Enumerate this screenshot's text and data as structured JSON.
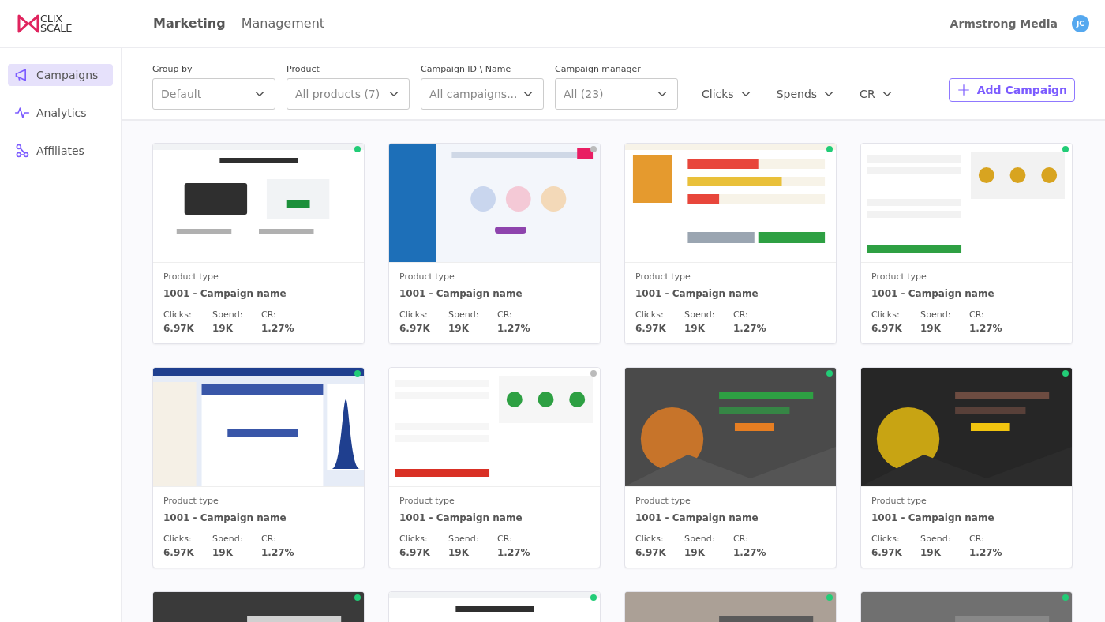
{
  "logo": {
    "line_1": "CLIX",
    "line_2": "SCALE"
  },
  "top_nav": [
    {
      "label": "Marketing",
      "selected": true
    },
    {
      "label": "Management",
      "selected": false
    }
  ],
  "account": {
    "name": "Armstrong Media",
    "avatar_initials": "JC"
  },
  "sidebar": {
    "items": [
      {
        "label": "Campaigns",
        "selected": true
      },
      {
        "label": "Analytics",
        "selected": false
      },
      {
        "label": "Affiliates",
        "selected": false
      }
    ]
  },
  "filters": [
    {
      "label": "Group by",
      "value": "Default"
    },
    {
      "label": "Product",
      "value": "All products (7)"
    },
    {
      "label": "Campaign ID \\ Name",
      "value": "All campaigns..."
    },
    {
      "label": "Campaign manager",
      "value": "All (23)"
    }
  ],
  "sort_menus": [
    "Clicks",
    "Spends",
    "CR"
  ],
  "add_button": "Add Campaign",
  "cards": [
    {
      "kind": "picture",
      "active": true,
      "product_type": "Product type",
      "name": "1001 - Campaign name",
      "stats": [
        {
          "label": "Clicks:",
          "value": "6.97K"
        },
        {
          "label": "Spend:",
          "value": "19K"
        },
        {
          "label": "CR:",
          "value": "1.27%"
        }
      ]
    },
    {
      "kind": "picture",
      "active": false,
      "product_type": "Product type",
      "name": "1001 - Campaign name",
      "stats": [
        {
          "label": "Clicks:",
          "value": "6.97K"
        },
        {
          "label": "Spend:",
          "value": "19K"
        },
        {
          "label": "CR:",
          "value": "1.27%"
        }
      ]
    },
    {
      "kind": "picture",
      "active": true,
      "product_type": "Product type",
      "name": "1001 - Campaign name",
      "stats": [
        {
          "label": "Clicks:",
          "value": "6.97K"
        },
        {
          "label": "Spend:",
          "value": "19K"
        },
        {
          "label": "CR:",
          "value": "1.27%"
        }
      ]
    },
    {
      "kind": "picture",
      "active": true,
      "product_type": "Product type",
      "name": "1001 - Campaign name",
      "stats": [
        {
          "label": "Clicks:",
          "value": "6.97K"
        },
        {
          "label": "Spend:",
          "value": "19K"
        },
        {
          "label": "CR:",
          "value": "1.27%"
        }
      ]
    },
    {
      "kind": "picture",
      "active": true,
      "product_type": "Product type",
      "name": "1001 - Campaign name",
      "stats": [
        {
          "label": "Clicks:",
          "value": "6.97K"
        },
        {
          "label": "Spend:",
          "value": "19K"
        },
        {
          "label": "CR:",
          "value": "1.27%"
        }
      ]
    },
    {
      "kind": "picture",
      "active": false,
      "product_type": "Product type",
      "name": "1001 - Campaign name",
      "stats": [
        {
          "label": "Clicks:",
          "value": "6.97K"
        },
        {
          "label": "Spend:",
          "value": "19K"
        },
        {
          "label": "CR:",
          "value": "1.27%"
        }
      ]
    },
    {
      "kind": "picture",
      "active": true,
      "product_type": "Product type",
      "name": "1001 - Campaign name",
      "stats": [
        {
          "label": "Clicks:",
          "value": "6.97K"
        },
        {
          "label": "Spend:",
          "value": "19K"
        },
        {
          "label": "CR:",
          "value": "1.27%"
        }
      ]
    },
    {
      "kind": "picture",
      "active": true,
      "product_type": "Product type",
      "name": "1001 - Campaign name",
      "stats": [
        {
          "label": "Clicks:",
          "value": "6.97K"
        },
        {
          "label": "Spend:",
          "value": "19K"
        },
        {
          "label": "CR:",
          "value": "1.27%"
        }
      ]
    },
    {
      "kind": "picture",
      "active": true
    },
    {
      "kind": "picture",
      "active": true
    },
    {
      "kind": "picture",
      "active": true
    },
    {
      "kind": "picture",
      "active": true
    }
  ]
}
